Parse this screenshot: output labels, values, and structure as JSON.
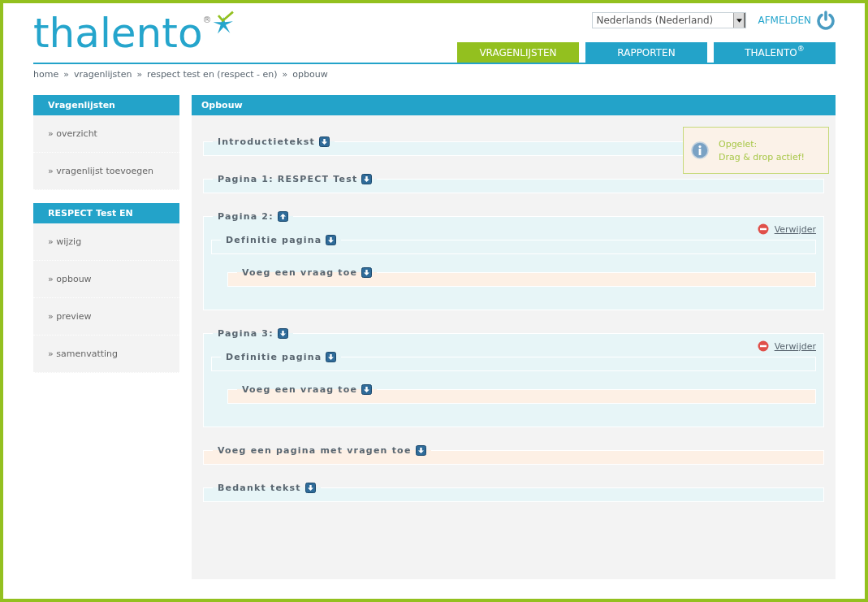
{
  "logo": {
    "text": "thalento",
    "mark": "®"
  },
  "language_select": {
    "value": "Nederlands (Nederland)"
  },
  "logout": {
    "label": "AFMELDEN"
  },
  "tabs": [
    {
      "label": "VRAGENLIJSTEN",
      "selected": true
    },
    {
      "label": "RAPPORTEN",
      "selected": false
    },
    {
      "label": "THALENTO",
      "sup": "®",
      "selected": false
    }
  ],
  "breadcrumb": [
    "home",
    "»",
    "vragenlijsten",
    "»",
    "respect test en (respect - en)",
    "»",
    "opbouw"
  ],
  "sidebar": [
    {
      "title": "Vragenlijsten",
      "items": [
        "» overzicht",
        "» vragenlijst toevoegen"
      ]
    },
    {
      "title": "RESPECT Test EN",
      "items": [
        "» wijzig",
        "» opbouw",
        "» preview",
        "» samenvatting"
      ]
    }
  ],
  "main": {
    "title": "Opbouw",
    "notice": {
      "lines": [
        "Opgelet:",
        "Drag & drop actief!"
      ]
    },
    "sections": [
      {
        "kind": "section",
        "legend": "Introductietekst",
        "expanded": false
      },
      {
        "kind": "section",
        "legend": "Pagina 1: RESPECT Test",
        "expanded": false
      },
      {
        "kind": "page",
        "legend": "Pagina 2:",
        "expanded": true,
        "delete": "Verwijder",
        "children": [
          {
            "kind": "section",
            "legend": "Definitie pagina",
            "expanded": false
          },
          {
            "kind": "add",
            "legend": "Voeg een vraag toe",
            "expanded": false
          }
        ]
      },
      {
        "kind": "page",
        "legend": "Pagina 3:",
        "expanded": false,
        "delete": "Verwijder",
        "children": [
          {
            "kind": "section",
            "legend": "Definitie pagina",
            "expanded": false
          },
          {
            "kind": "add",
            "legend": "Voeg een vraag toe",
            "expanded": false
          }
        ]
      },
      {
        "kind": "add",
        "legend": "Voeg een pagina met vragen toe",
        "expanded": false
      },
      {
        "kind": "section",
        "legend": "Bedankt tekst",
        "expanded": false
      }
    ]
  }
}
